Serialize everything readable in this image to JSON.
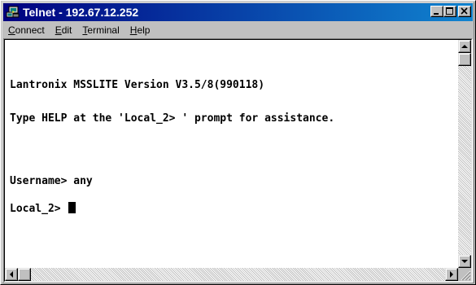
{
  "window": {
    "title": "Telnet - 192.67.12.252",
    "title_gradient": [
      "#000080",
      "#1084d0"
    ],
    "icon": "telnet-computer-icon",
    "buttons": {
      "minimize": "minimize-icon",
      "maximize": "maximize-icon",
      "close": "close-icon"
    }
  },
  "menu": {
    "items": [
      {
        "accel": "C",
        "rest": "onnect"
      },
      {
        "accel": "E",
        "rest": "dit"
      },
      {
        "accel": "T",
        "rest": "erminal"
      },
      {
        "accel": "H",
        "rest": "elp"
      }
    ]
  },
  "terminal": {
    "lines": [
      "Lantronix MSSLITE Version V3.5/8(990118)",
      "Type HELP at the 'Local_2> ' prompt for assistance.",
      "Username> any",
      "Local_2> "
    ],
    "background": "#ffffff",
    "foreground": "#000000"
  },
  "scrollbars": {
    "vertical_position": 0,
    "horizontal_position": 0
  }
}
